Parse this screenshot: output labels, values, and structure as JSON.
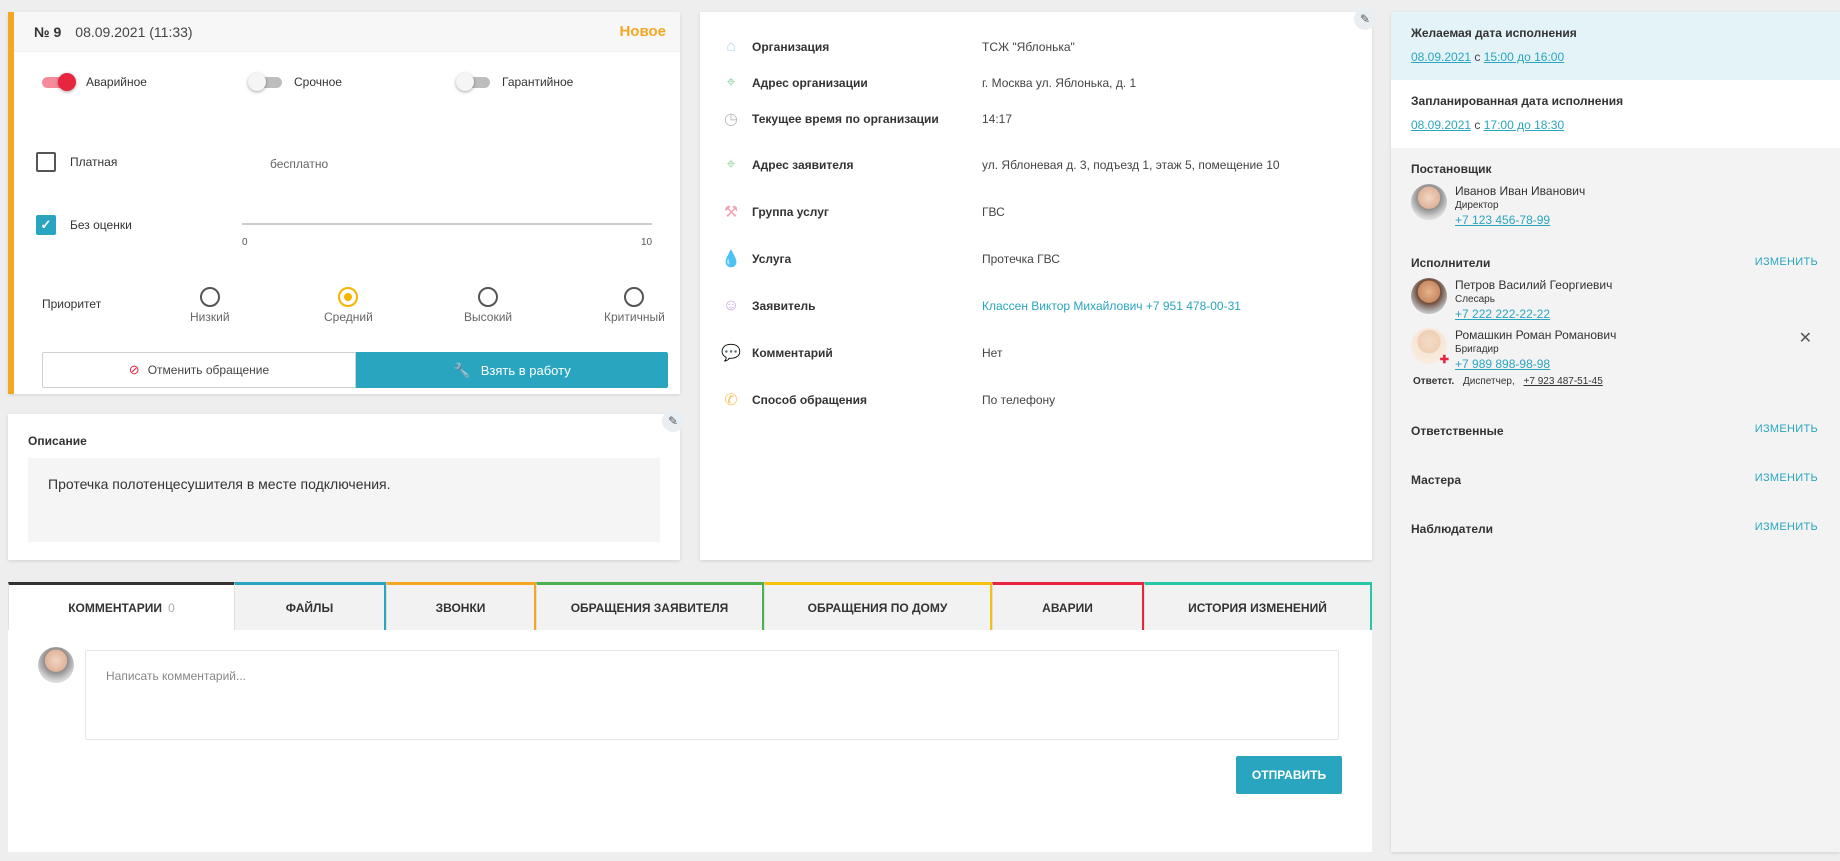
{
  "order": {
    "number": "№ 9",
    "datetime": "08.09.2021 (11:33)",
    "status": "Новое",
    "status_color": "#f5a623",
    "toggles": [
      {
        "label": "Аварийное",
        "on": true
      },
      {
        "label": "Срочное",
        "on": false
      },
      {
        "label": "Гарантийное",
        "on": false
      }
    ],
    "paid": {
      "label": "Платная",
      "checked": false,
      "price_text": "бесплатно"
    },
    "no_rating": {
      "label": "Без оценки",
      "checked": true,
      "slider_min": "0",
      "slider_max": "10"
    },
    "priority": {
      "label": "Приоритет",
      "options": [
        "Низкий",
        "Средний",
        "Высокий",
        "Критичный"
      ],
      "selected": "Средний"
    },
    "cancel_label": "Отменить обращение",
    "take_label": "Взять в работу"
  },
  "description": {
    "title": "Описание",
    "text": "Протечка полотенцесушителя в месте подключения."
  },
  "info": {
    "rows": [
      {
        "icon": "home-icon",
        "label": "Организация",
        "value": "ТСЖ \"Яблонька\""
      },
      {
        "icon": "location-icon",
        "label": "Адрес организации",
        "value": "г. Москва ул. Яблонька, д. 1"
      },
      {
        "icon": "clock-icon",
        "label": "Текущее время по организации",
        "value": "14:17"
      },
      {
        "icon": "location-icon",
        "label": "Адрес заявителя",
        "value": "ул. Яблоневая д. 3, подъезд 1, этаж 5, помещение 10"
      },
      {
        "icon": "wrench-icon",
        "label": "Группа услуг",
        "value": "ГВС"
      },
      {
        "icon": "drop-icon",
        "label": "Услуга",
        "value": "Протечка ГВС"
      },
      {
        "icon": "user-icon",
        "label": "Заявитель",
        "value": "Классен Виктор Михайлович +7 951 478-00-31"
      },
      {
        "icon": "chat-icon",
        "label": "Комментарий",
        "value": "Нет"
      },
      {
        "icon": "phone-icon",
        "label": "Способ обращения",
        "value": "По телефону"
      }
    ]
  },
  "tabs": [
    {
      "label": "КОММЕНТАРИИ",
      "count": "0",
      "color": "#333333"
    },
    {
      "label": "ФАЙЛЫ",
      "color": "#2aa5bf"
    },
    {
      "label": "ЗВОНКИ",
      "color": "#f5a623"
    },
    {
      "label": "ОБРАЩЕНИЯ ЗАЯВИТЕЛЯ",
      "color": "#4caf50"
    },
    {
      "label": "ОБРАЩЕНИЯ ПО ДОМУ",
      "color": "#f4c20d"
    },
    {
      "label": "АВАРИИ",
      "color": "#e8253f"
    },
    {
      "label": "ИСТОРИЯ ИЗМЕНЕНИЙ",
      "color": "#26c6a6"
    }
  ],
  "comments": {
    "placeholder": "Написать комментарий...",
    "send_label": "ОТПРАВИТЬ"
  },
  "right": {
    "desired": {
      "title": "Желаемая дата исполнения",
      "date": "08.09.2021",
      "from_word": "с",
      "range": "15:00 до 16:00"
    },
    "planned": {
      "title": "Запланированная дата исполнения",
      "date": "08.09.2021",
      "from_word": "с",
      "range": "17:00 до 18:30"
    },
    "creator": {
      "title": "Постановщик",
      "name": "Иванов Иван Иванович",
      "role": "Директор",
      "phone": "+7 123 456-78-99"
    },
    "executors": {
      "title": "Исполнители",
      "change_label": "ИЗМЕНИТЬ",
      "people": [
        {
          "name": "Петров Василий Георгиевич",
          "role": "Слесарь",
          "phone": "+7 222 222-22-22"
        },
        {
          "name": "Ромашкин Роман Романович",
          "role": "Бригадир",
          "phone": "+7 989 898-98-98"
        }
      ],
      "responsible_prefix": "Ответст.",
      "responsible_role": "Диспетчер,",
      "responsible_phone": "+7 923 487-51-45"
    },
    "responsible": {
      "title": "Ответственные",
      "change_label": "ИЗМЕНИТЬ"
    },
    "masters": {
      "title": "Мастера",
      "change_label": "ИЗМЕНИТЬ"
    },
    "observers": {
      "title": "Наблюдатели",
      "change_label": "ИЗМЕНИТЬ"
    }
  }
}
